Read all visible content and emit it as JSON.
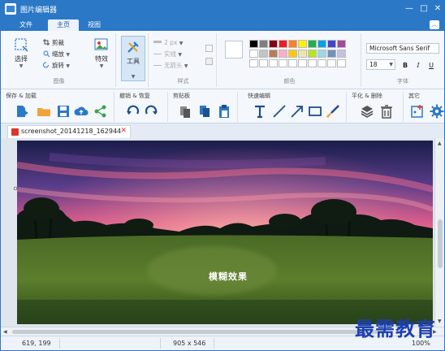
{
  "window": {
    "title": "图片编辑器",
    "minimize": "—",
    "maximize": "□",
    "close": "✕"
  },
  "tabs": [
    "文件",
    "主页",
    "视图"
  ],
  "collapse_glyph": "︿",
  "ribbon": {
    "image_group": {
      "label": "图像",
      "select": "选择",
      "crop": "剪裁",
      "resize": "缩放",
      "rotate": "旋转",
      "effects": "特效"
    },
    "tools_group": {
      "tool": "工具"
    },
    "style_group": {
      "label": "样式",
      "size": "2 px",
      "line": "实线",
      "arrow": "无箭头"
    },
    "colors_group": {
      "label": "颜色",
      "palette_row1": [
        "#000000",
        "#7f7f7f",
        "#880015",
        "#ed1c24",
        "#ff7f27",
        "#fff200",
        "#22b14c",
        "#00a2e8",
        "#3f48cc",
        "#a349a4"
      ],
      "palette_row2": [
        "#ffffff",
        "#c3c3c3",
        "#b97a57",
        "#ffaec9",
        "#ffc90e",
        "#efe4b0",
        "#b5e61d",
        "#99d9ea",
        "#7092be",
        "#c8bfe7"
      ],
      "palette_row3": [
        "#ffffff",
        "#ffffff",
        "#ffffff",
        "#ffffff",
        "#ffffff",
        "#ffffff",
        "#ffffff",
        "#ffffff",
        "#ffffff",
        "#ffffff"
      ]
    },
    "font_group": {
      "label": "字体",
      "font_name": "Microsoft Sans Serif",
      "font_size": "18",
      "bold": "B",
      "italic": "I",
      "underline": "U"
    }
  },
  "toolbar2": {
    "save_load": "保存 & 加载",
    "undo_redo": "撤销 & 恢复",
    "clipboard": "剪贴板",
    "quick_edit": "快速编辑",
    "flatten_delete": "平化 & 删除",
    "other": "其它"
  },
  "document": {
    "tab_name": "screenshot_20141218_162944",
    "close": "✕",
    "overlay_text": "模糊效果"
  },
  "status": {
    "coords": "619, 199",
    "dimensions": "905 x 546",
    "zoom": "100%"
  },
  "watermark": "最需教育"
}
